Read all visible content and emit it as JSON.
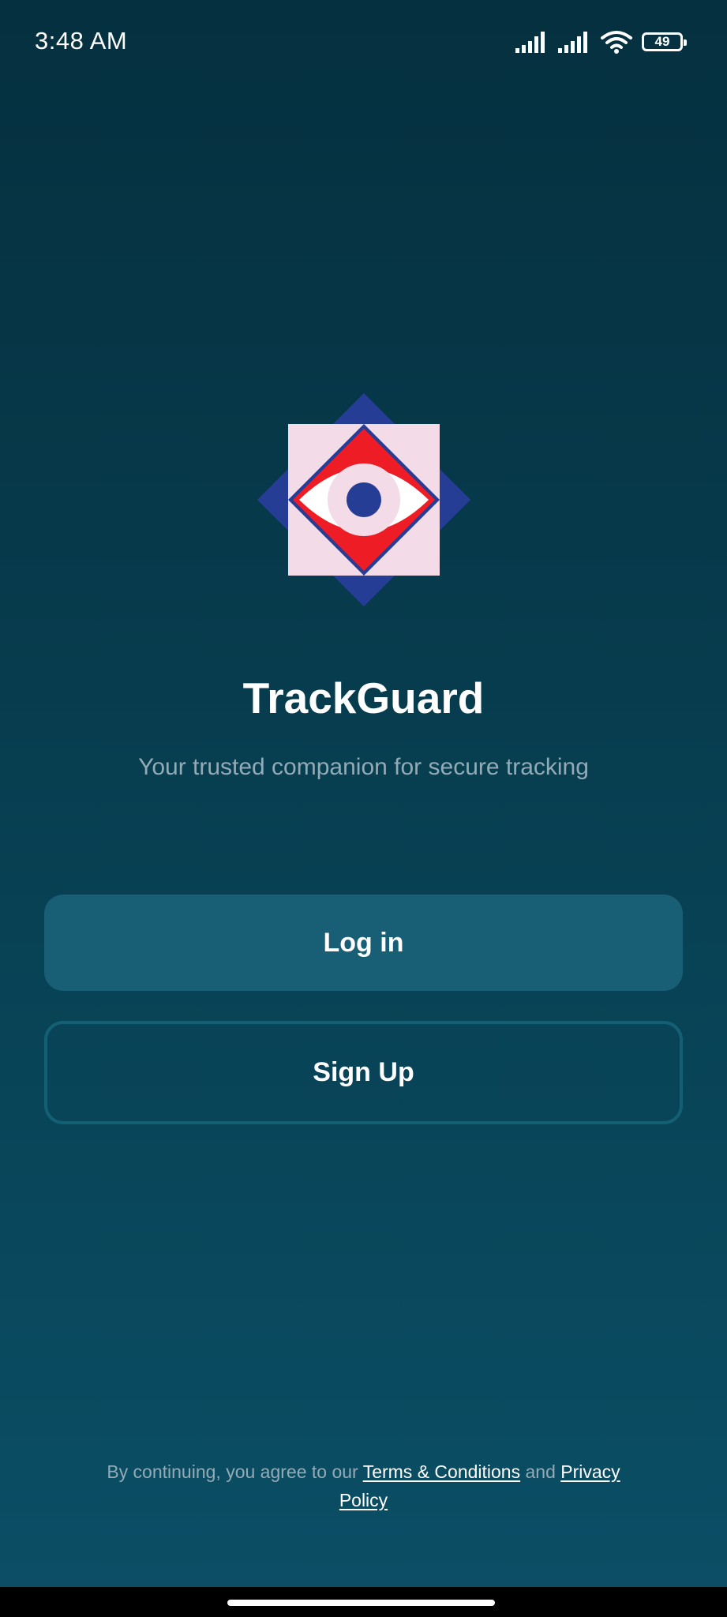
{
  "status_bar": {
    "time": "3:48 AM",
    "battery": "49",
    "icons": [
      "signal-icon",
      "signal-icon",
      "wifi-icon",
      "battery-icon"
    ]
  },
  "logo": {
    "icon": "eye-shield-logo",
    "colors": {
      "outer_diamond": "#263d96",
      "square": "#f3dbe7",
      "inner_diamond": "#ee1c25",
      "eye_white": "#ffffff",
      "iris": "#f3dbe7",
      "pupil": "#263d96"
    }
  },
  "app": {
    "name": "TrackGuard",
    "tagline": "Your trusted companion for secure tracking"
  },
  "actions": {
    "login_label": "Log in",
    "signup_label": "Sign Up"
  },
  "legal": {
    "prefix": "By continuing, you agree to our ",
    "terms_link": "Terms & Conditions",
    "middle": " and ",
    "privacy_link": "Privacy Policy"
  },
  "theme": {
    "background_top": "#05303f",
    "background_bottom": "#0b4f66",
    "login_button": "#185e74",
    "signup_border": "#136074",
    "muted_text": "#93abb6"
  }
}
